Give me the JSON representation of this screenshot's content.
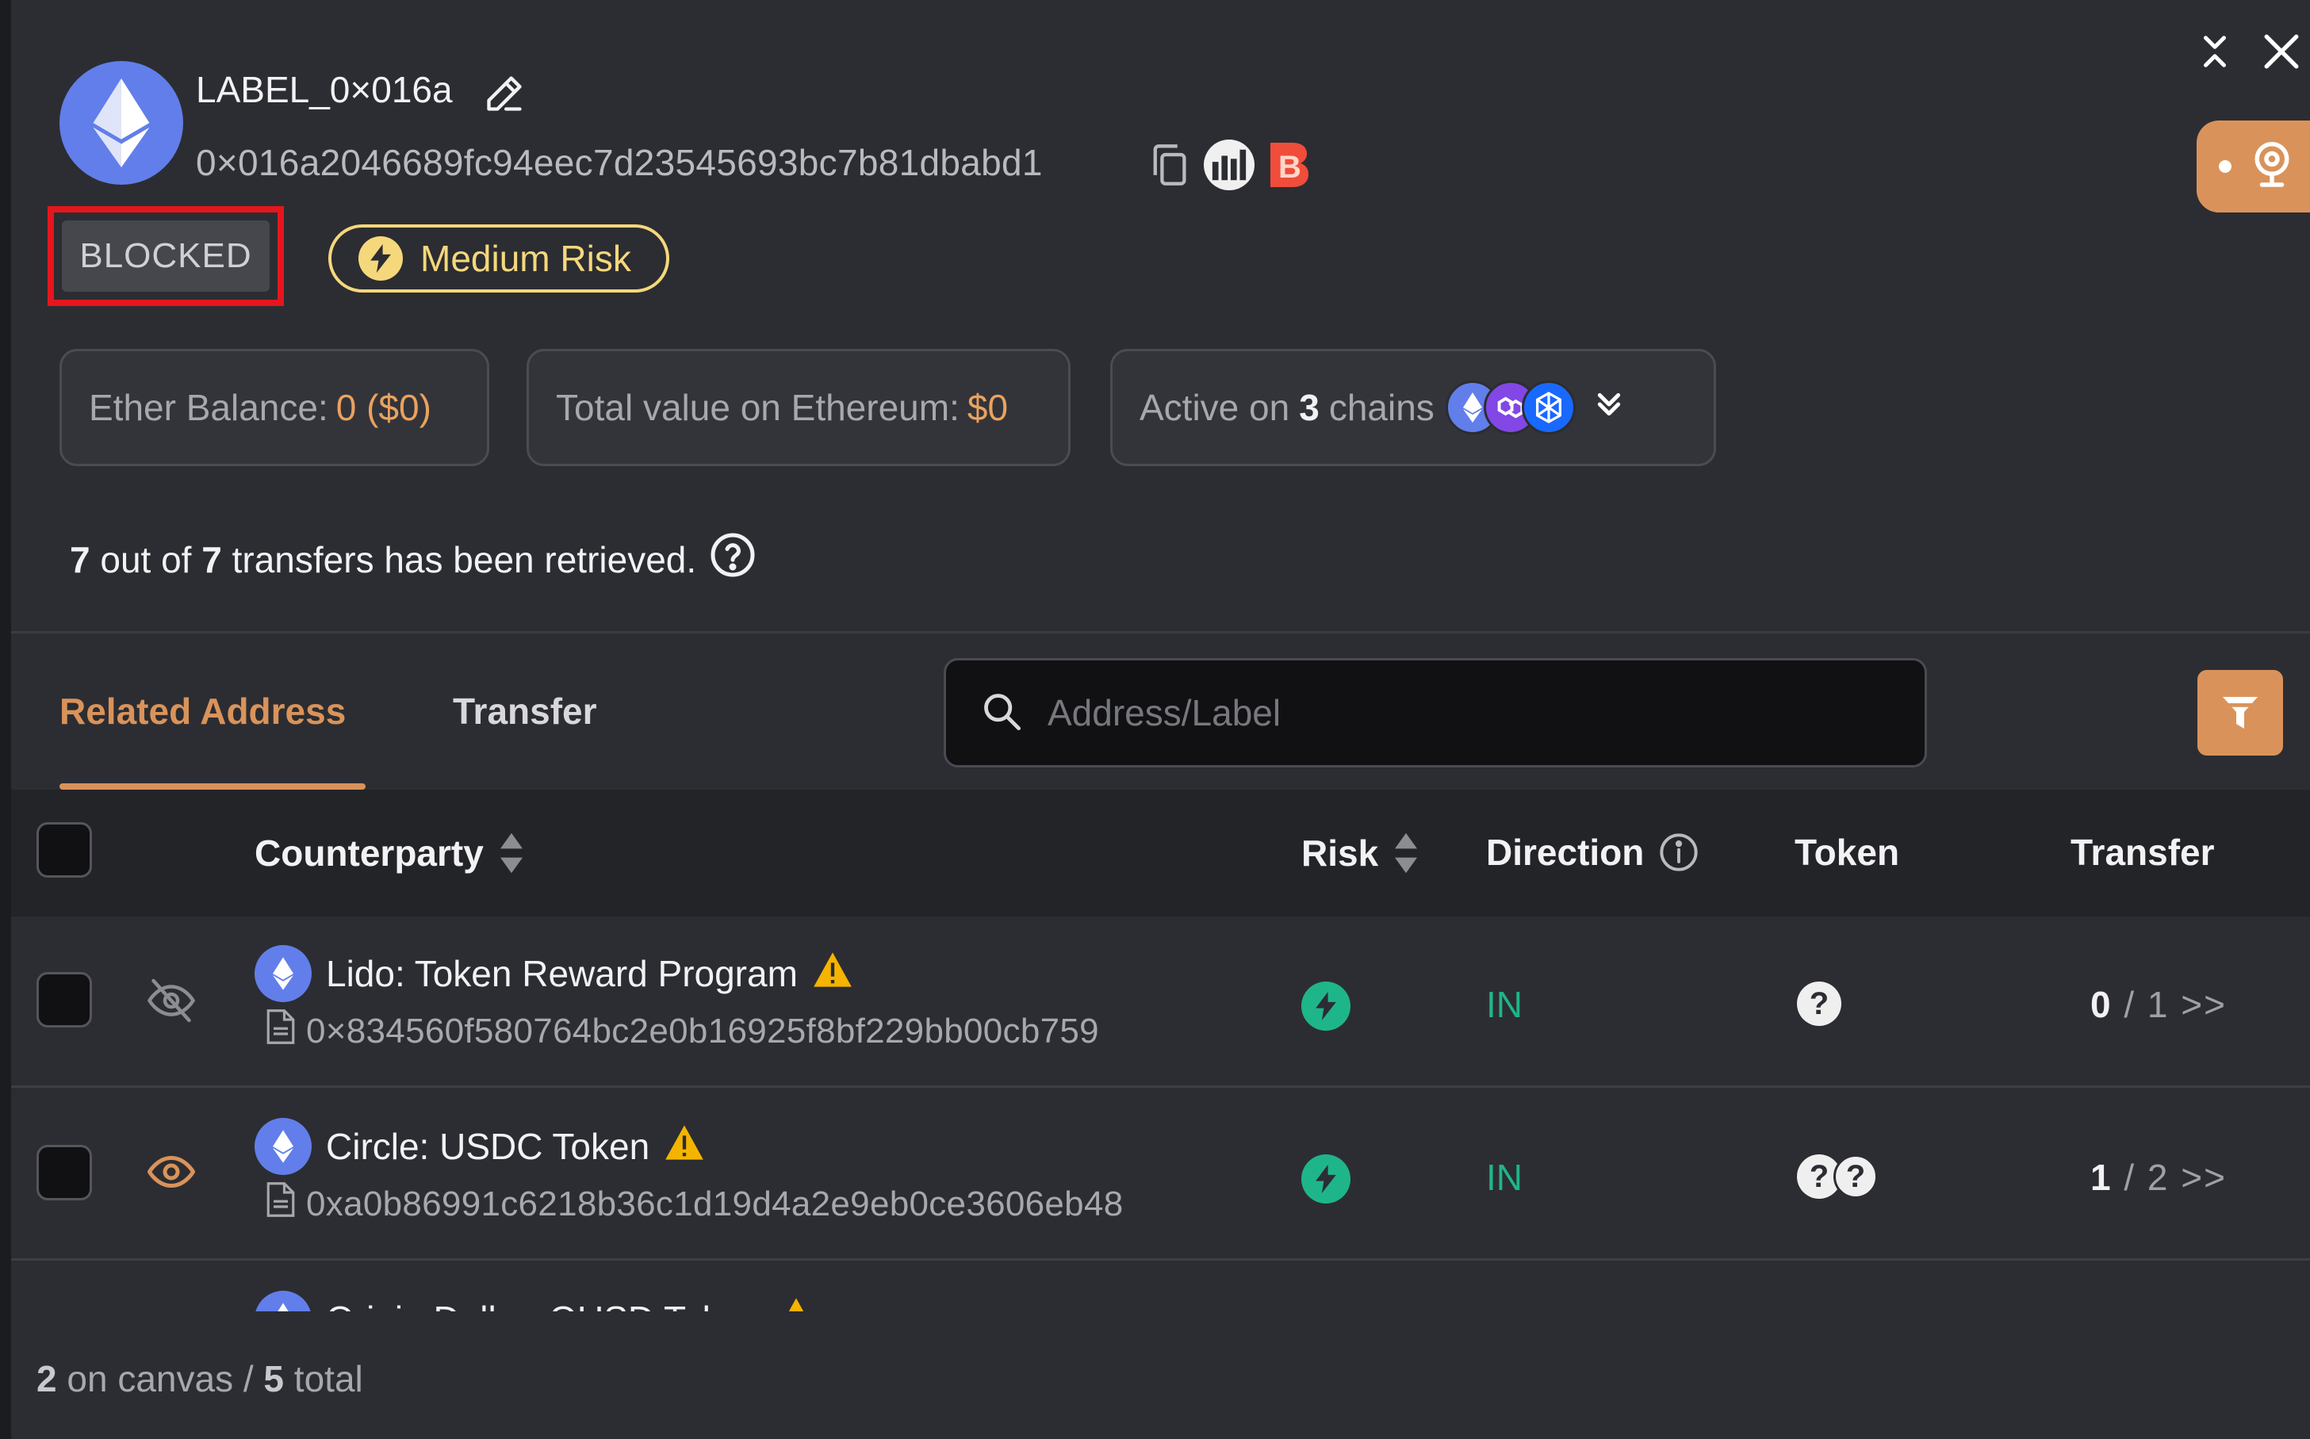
{
  "header": {
    "label": "LABEL_0×016a",
    "address": "0×016a2046689fc94eec7d23545693bc7b81dbabd1",
    "b_badge": "B"
  },
  "tags": {
    "blocked": "BLOCKED",
    "risk": "Medium Risk"
  },
  "cards": {
    "ether_balance_label": "Ether Balance:",
    "ether_balance_value": "0 ($0)",
    "total_value_label": "Total value on Ethereum:",
    "total_value_value": "$0",
    "active_prefix": "Active on",
    "active_count": "3",
    "active_suffix": "chains"
  },
  "retrieved": {
    "count": "7",
    "middle": "out of",
    "total": "7",
    "suffix": "transfers has been retrieved."
  },
  "tabs": {
    "related": "Related Address",
    "transfer": "Transfer"
  },
  "search": {
    "placeholder": "Address/Label"
  },
  "table": {
    "headers": {
      "counterparty": "Counterparty",
      "risk": "Risk",
      "direction": "Direction",
      "token": "Token",
      "transfer": "Transfer"
    },
    "rows": [
      {
        "name": "Lido: Token Reward Program",
        "address": "0×834560f580764bc2e0b16925f8bf229bb00cb759",
        "direction": "IN",
        "transfer_count": "0",
        "transfer_rest": "/ 1 >>",
        "token_icons": [
          "?"
        ],
        "visibility": "hidden"
      },
      {
        "name": "Circle: USDC Token",
        "address": "0xa0b86991c6218b36c1d19d4a2e9eb0ce3606eb48",
        "direction": "IN",
        "transfer_count": "1",
        "transfer_rest": "/ 2 >>",
        "token_icons": [
          "?",
          "?"
        ],
        "visibility": "visible"
      }
    ],
    "partial_row_name": "Origin Dollar: OUSD Token"
  },
  "footer": {
    "canvas_count": "2",
    "canvas_text": "on canvas /",
    "total_count": "5",
    "total_text": "total"
  },
  "colors": {
    "accent": "#d9935a",
    "blocked_border": "#e5161d",
    "risk_yellow": "#f5d87b",
    "green": "#1fb58a",
    "eth": "#627eea"
  }
}
